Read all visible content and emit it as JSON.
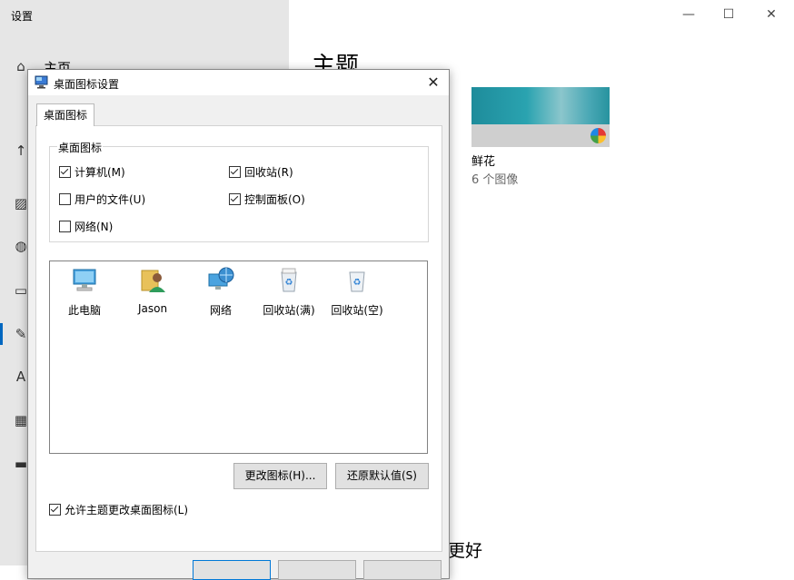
{
  "settings": {
    "window_title": "设置",
    "nav_home_label": "主页",
    "page_heading": "主题",
    "bottom_heading": "更好",
    "window_controls": {
      "minimize": "—",
      "maximize": "☐",
      "close": "✕"
    },
    "theme": {
      "name": "鲜花",
      "count": "6 个图像"
    }
  },
  "dialog": {
    "title": "桌面图标设置",
    "close": "✕",
    "tab_label": "桌面图标",
    "group_legend": "桌面图标",
    "checkboxes": [
      {
        "label": "计算机(M)",
        "checked": true
      },
      {
        "label": "回收站(R)",
        "checked": true
      },
      {
        "label": "用户的文件(U)",
        "checked": false
      },
      {
        "label": "控制面板(O)",
        "checked": true
      },
      {
        "label": "网络(N)",
        "checked": false
      }
    ],
    "icons": [
      {
        "label": "此电脑",
        "icon": "computer-icon"
      },
      {
        "label": "Jason",
        "icon": "user-folder-icon"
      },
      {
        "label": "网络",
        "icon": "network-icon"
      },
      {
        "label": "回收站(满)",
        "icon": "recycle-bin-full-icon"
      },
      {
        "label": "回收站(空)",
        "icon": "recycle-bin-empty-icon"
      }
    ],
    "change_icon_button": "更改图标(H)...",
    "restore_default_button": "还原默认值(S)",
    "allow_themes_checkbox": {
      "label": "允许主题更改桌面图标(L)",
      "checked": true
    }
  }
}
